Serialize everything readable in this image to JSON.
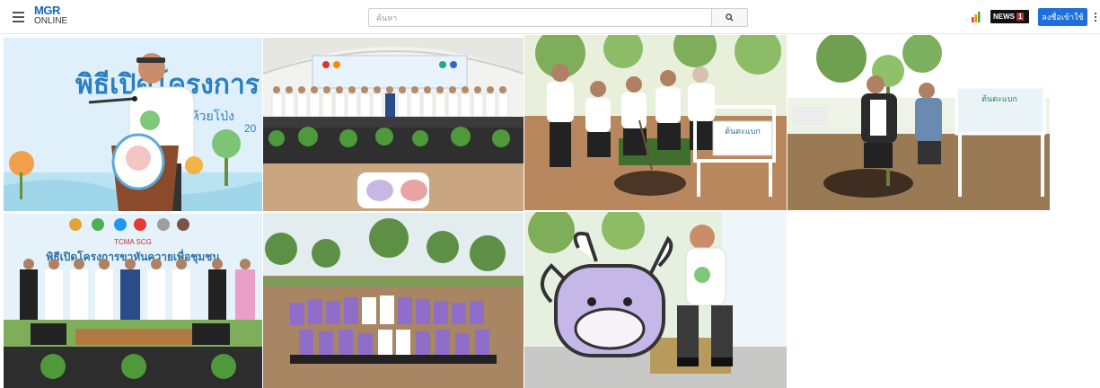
{
  "header": {
    "logo_top": "MGR",
    "logo_bottom": "ONLINE",
    "search_placeholder": "ค้นหา",
    "news_badge": "NEWS",
    "news_badge_num": "1",
    "login_label": "ลงชื่อเข้าใช้"
  },
  "gallery": {
    "photo1": {
      "banner_title": "พิธีเปิดโครงการ",
      "banner_sub": "บนห้วยโป่ง",
      "banner_year": "20"
    },
    "photo2": {
      "banner_title": ""
    },
    "photo3": {
      "sign_text": "ต้นตะแบก"
    },
    "photo4": {
      "sign_text": "ต้นตะแบก"
    },
    "photo5": {
      "banner_logos": "TCMA  SCG",
      "banner_title": "พิธีเปิดโครงการขาหันควายเพื่อชุมชน"
    }
  },
  "colors": {
    "brand_blue": "#1565c0",
    "brand_red": "#d32f2f",
    "login_blue": "#1e6fd9"
  }
}
